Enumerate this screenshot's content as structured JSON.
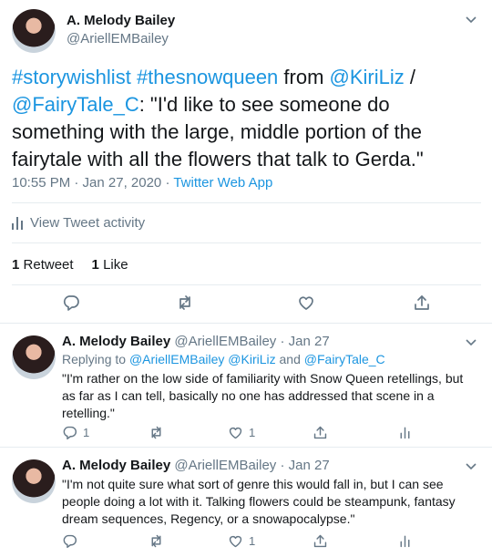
{
  "main_tweet": {
    "author_name": "A. Melody Bailey",
    "author_handle": "@AriellEMBailey",
    "text_parts": {
      "hashtag1": "#storywishlist",
      "hashtag2": "#thesnowqueen",
      "from": " from ",
      "mention1": "@KiriLiz",
      "slash": " /",
      "mention2": "@FairyTale_C",
      "quote": ": \"I'd like to see someone do something with the large, middle portion of the fairytale with all the flowers that talk to Gerda.\""
    },
    "time": "10:55 PM · Jan 27, 2020 · ",
    "source": "Twitter Web App",
    "activity_label": "View Tweet activity",
    "retweets_count": "1",
    "retweets_label": "Retweet",
    "likes_count": "1",
    "likes_label": "Like"
  },
  "replies": [
    {
      "author_name": "A. Melody Bailey",
      "author_handle": "@AriellEMBailey",
      "date": " · Jan 27",
      "replying_prefix": "Replying to ",
      "replying_mentions": "@AriellEMBailey @KiriLiz",
      "replying_and": " and ",
      "replying_last": "@FairyTale_C",
      "text": "\"I'm rather on the low side of familiarity with Snow Queen retellings, but as far as I can tell, basically no one has addressed that scene in a retelling.\"",
      "reply_count": "1",
      "retweet_count": "",
      "like_count": "1"
    },
    {
      "author_name": "A. Melody Bailey",
      "author_handle": "@AriellEMBailey",
      "date": " · Jan 27",
      "text": "\"I'm not quite sure what sort of genre this would fall in, but I can see people doing a lot with it. Talking flowers could be steampunk, fantasy dream sequences, Regency, or a snowapocalypse.\"",
      "reply_count": "",
      "retweet_count": "",
      "like_count": "1"
    }
  ],
  "colors": {
    "link": "#1b95e0",
    "muted": "#657786",
    "text": "#14171a",
    "border": "#e6ecf0"
  },
  "icons": [
    "chevron-down-icon",
    "reply-icon",
    "retweet-icon",
    "like-icon",
    "share-icon",
    "analytics-icon"
  ]
}
